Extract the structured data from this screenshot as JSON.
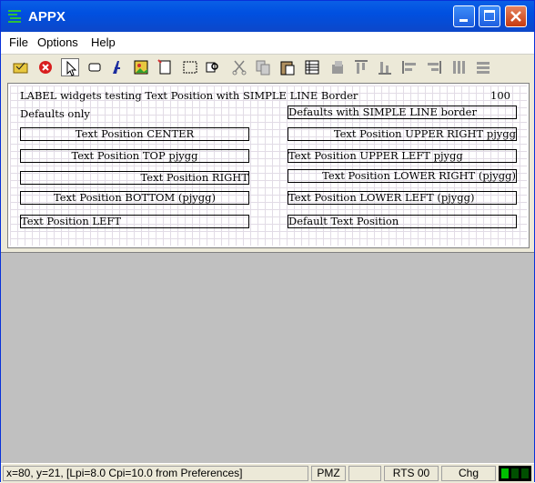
{
  "window": {
    "title": "APPX"
  },
  "menu": {
    "file": "File",
    "options": "Options",
    "help": "Help"
  },
  "toolbar": {
    "tools": [
      "open-folder-icon",
      "stop-icon",
      "pointer-icon",
      "button-icon",
      "text-icon",
      "image-icon",
      "page-icon",
      "rectangle-icon",
      "find-icon",
      "cut-icon",
      "copy-icon",
      "paste-icon",
      "table-icon",
      "align-icon-1",
      "align-icon-2",
      "align-icon-3",
      "align-icon-4",
      "align-icon-5",
      "align-icon-6",
      "align-icon-7"
    ]
  },
  "panel": {
    "header": "LABEL widgets testing Text Position with SIMPLE LINE Border",
    "number": "100",
    "left_heading": "Defaults only",
    "right_heading": "Defaults with SIMPLE LINE border",
    "left": [
      "Text Position CENTER",
      "Text Position TOP pjygg",
      "Text Position RIGHT",
      "Text Position BOTTOM (pjygg)",
      "Text Position LEFT"
    ],
    "right": [
      "Text Position UPPER RIGHT pjygg",
      "Text Position UPPER LEFT pjygg",
      "Text Position LOWER RIGHT (pjygg)",
      "Text Position LOWER LEFT (pjygg)",
      "Default Text Position"
    ]
  },
  "status": {
    "message": "x=80, y=21, [Lpi=8.0 Cpi=10.0 from Preferences]",
    "pmz": "PMZ",
    "rts": "RTS 00",
    "chg": "Chg"
  },
  "colors": {
    "title_blue": "#0050E0",
    "grid": "#E2DCE6",
    "led_green": "#00C000"
  }
}
